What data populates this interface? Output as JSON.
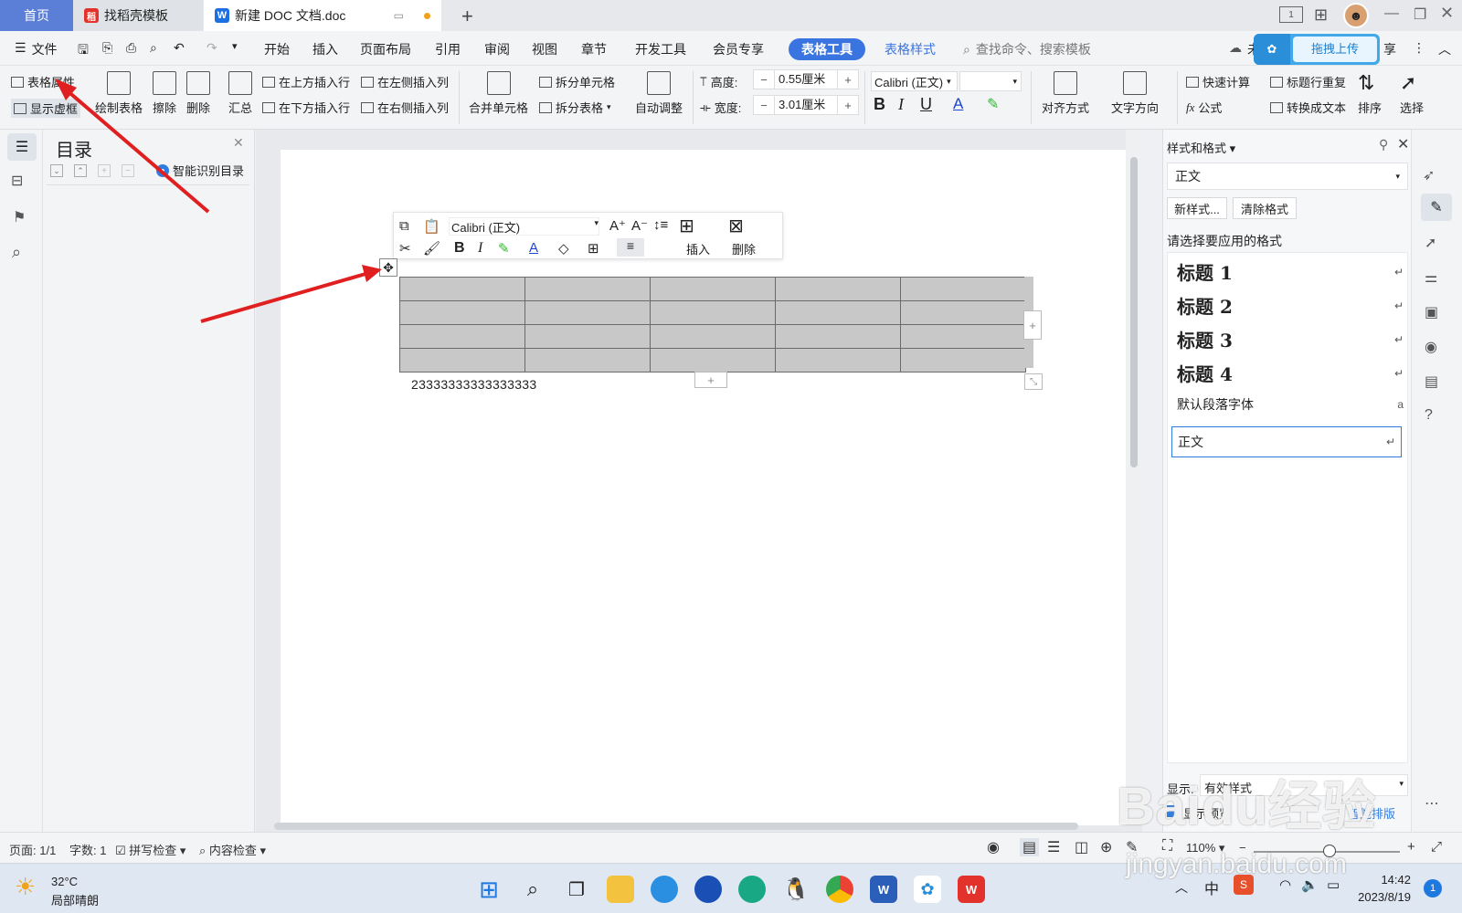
{
  "tabs": {
    "home": "首页",
    "template": "找稻壳模板",
    "document": "新建 DOC 文档.doc"
  },
  "menu": {
    "file": "文件",
    "items": [
      "开始",
      "插入",
      "页面布局",
      "引用",
      "审阅",
      "视图",
      "章节",
      "开发工具",
      "会员专享"
    ],
    "table_tools": "表格工具",
    "table_style": "表格样式",
    "search_placeholder": "查找命令、搜索模板",
    "share_partial": "享",
    "cloud_partial": "未"
  },
  "upload": {
    "label": "拖拽上传"
  },
  "ribbon": {
    "table_props": "表格属性",
    "show_gridlines": "显示虚框",
    "draw_table": "绘制表格",
    "erase": "擦除",
    "delete": "删除",
    "summary": "汇总",
    "insert_row_above": "在上方插入行",
    "insert_row_below": "在下方插入行",
    "insert_col_left": "在左侧插入列",
    "insert_col_right": "在右侧插入列",
    "merge_cells": "合并单元格",
    "split_cells": "拆分单元格",
    "split_table": "拆分表格",
    "auto_fit": "自动调整",
    "height_label": "高度:",
    "height_value": "0.55厘米",
    "width_label": "宽度:",
    "width_value": "3.01厘米",
    "font": "Calibri (正文)",
    "align": "对齐方式",
    "text_dir": "文字方向",
    "quick_calc": "快速计算",
    "formula": "公式",
    "header_repeat": "标题行重复",
    "convert_text": "转换成文本",
    "sort": "排序",
    "select": "选择"
  },
  "toc": {
    "title": "目录",
    "smart": "智能识别目录"
  },
  "mini_toolbar": {
    "font": "Calibri (正文)",
    "insert": "插入",
    "delete": "删除"
  },
  "document": {
    "table_rows": 4,
    "table_cols": 5,
    "text": "23333333333333333"
  },
  "style_panel": {
    "title": "样式和格式",
    "current": "正文",
    "new_style": "新样式...",
    "clear_format": "清除格式",
    "prompt": "请选择要应用的格式",
    "styles": [
      {
        "name": "标题  1",
        "mark": "↵"
      },
      {
        "name": "标题  2",
        "mark": "↵"
      },
      {
        "name": "标题  3",
        "mark": "↵"
      },
      {
        "name": "标题  4",
        "mark": "↵"
      },
      {
        "name": "默认段落字体",
        "mark": "a"
      },
      {
        "name": "正文",
        "mark": "↵"
      }
    ],
    "show_label": "显示:",
    "show_value": "有效样式",
    "preview": "显示预览",
    "smart_layout": "智能排版"
  },
  "status": {
    "page": "页面: 1/1",
    "words": "字数: 1",
    "spell": "拼写检查",
    "content_check": "内容检查",
    "zoom": "110%"
  },
  "taskbar": {
    "temp": "32°C",
    "weather": "局部晴朗",
    "ime": "中",
    "time": "14:42",
    "date": "2023/8/19",
    "badge": "1"
  },
  "watermark": {
    "main": "Baidu经验",
    "sub": "jingyan.baidu.com"
  },
  "colors": {
    "accent": "#3a74e0",
    "home_tab": "#5b7fd6",
    "table_fill": "#c8c8c8",
    "arrow": "#e02020"
  }
}
